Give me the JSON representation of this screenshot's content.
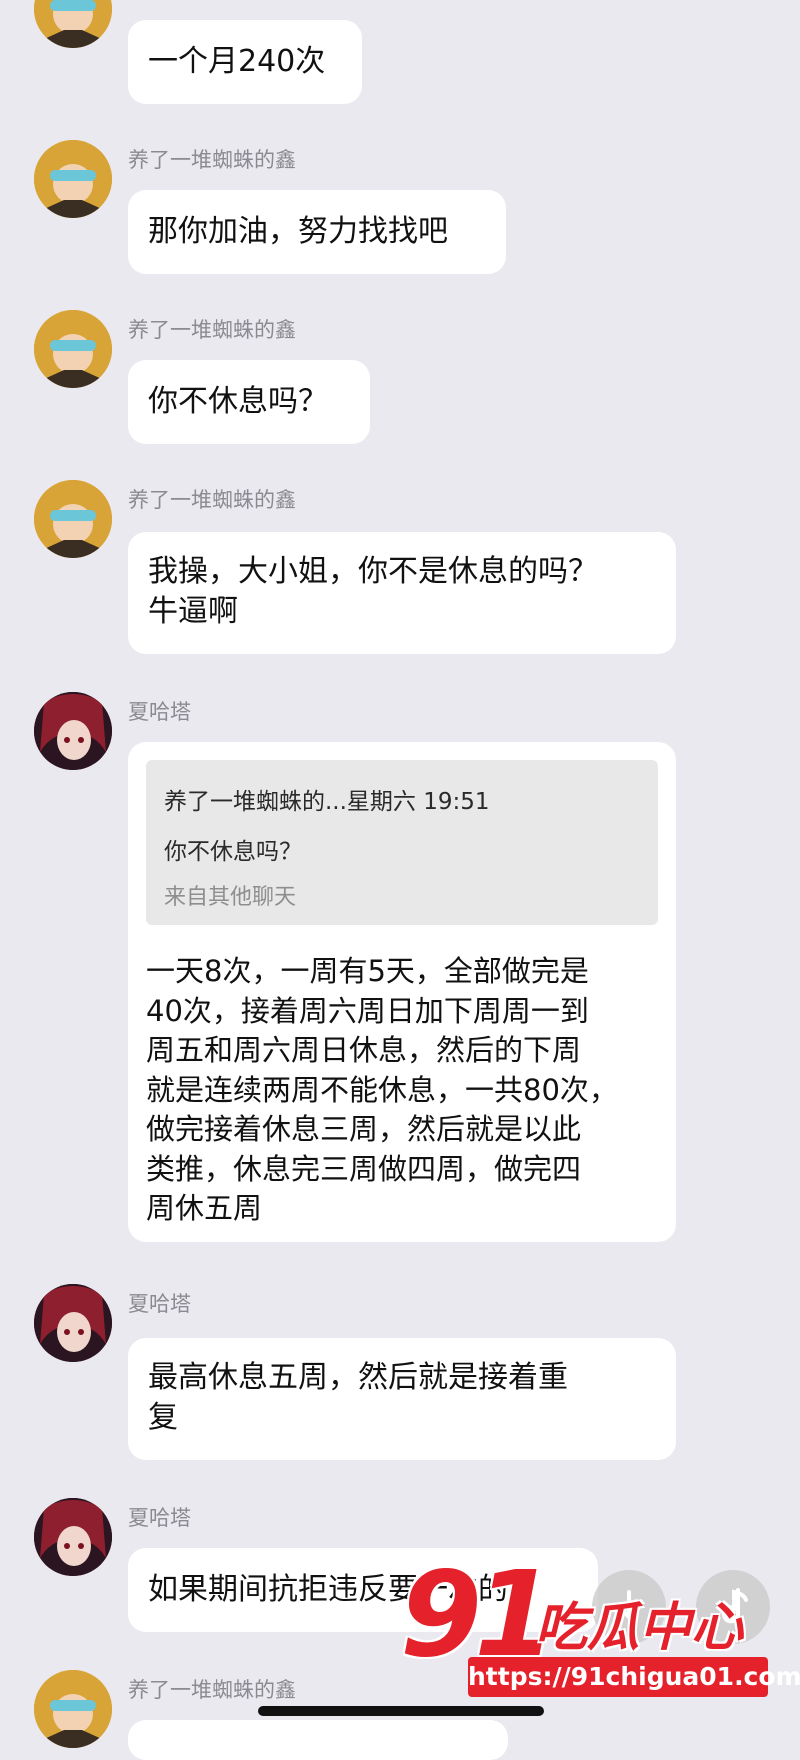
{
  "messages": [
    {
      "id": 1,
      "sender": "",
      "avatar": "goggles-character-avatar",
      "text": "一个月240次"
    },
    {
      "id": 2,
      "sender": "养了一堆蜘蛛的鑫",
      "avatar": "goggles-character-avatar",
      "text": "那你加油，努力找找吧"
    },
    {
      "id": 3,
      "sender": "养了一堆蜘蛛的鑫",
      "avatar": "goggles-character-avatar",
      "text": "你不休息吗？"
    },
    {
      "id": 4,
      "sender": "养了一堆蜘蛛的鑫",
      "avatar": "goggles-character-avatar",
      "lines": [
        "我操，大小姐，你不是休息的吗？",
        "牛逼啊"
      ]
    },
    {
      "id": 5,
      "sender": "夏哈塔",
      "avatar": "red-hair-character-avatar",
      "quote": {
        "header": "养了一堆蜘蛛的...星期六 19:51",
        "text": "你不休息吗？",
        "source": "来自其他聊天"
      },
      "lines": [
        "一天8次，一周有5天，全部做完是",
        "40次，接着周六周日加下周周一到",
        "周五和周六周日休息，然后的下周",
        "就是连续两周不能休息，一共80次，",
        "做完接着休息三周，然后就是以此",
        "类推，休息完三周做四周，做完四",
        "周休五周"
      ]
    },
    {
      "id": 6,
      "sender": "夏哈塔",
      "avatar": "red-hair-character-avatar",
      "lines": [
        "最高休息五周，然后就是接着重",
        "复"
      ]
    },
    {
      "id": 7,
      "sender": "夏哈塔",
      "avatar": "red-hair-character-avatar",
      "text": "如果期间抗拒违反要一次的"
    },
    {
      "id": 8,
      "sender": "养了一堆蜘蛛的鑫",
      "avatar": "goggles-character-avatar",
      "text": ""
    }
  ],
  "watermark": {
    "number": "91",
    "title": "吃瓜中心",
    "url": "https://91chigua01.com"
  },
  "colors": {
    "background": "#ebe9f0",
    "bubble": "#ffffff",
    "quote_bg": "#e8e8e8",
    "name": "#8a8a90",
    "watermark_red": "#e5212b"
  }
}
